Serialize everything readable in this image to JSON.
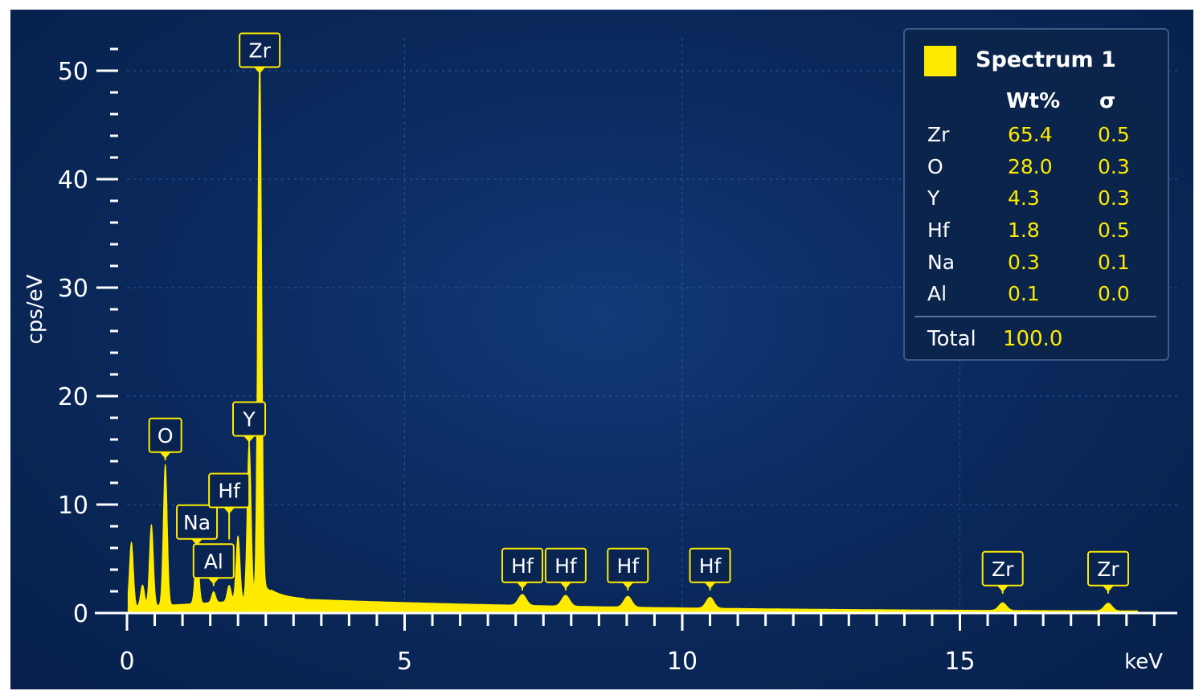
{
  "chart_data": {
    "type": "area",
    "xlabel": "keV",
    "ylabel": "cps/eV",
    "xlim": [
      0,
      18.5
    ],
    "ylim": [
      0,
      53
    ],
    "x_ticks": [
      0,
      5,
      10,
      15
    ],
    "y_ticks": [
      0,
      10,
      20,
      30,
      40,
      50
    ],
    "series_color": "#ffeb00",
    "background_color": "#0b2a5e",
    "background_level": 0.5,
    "peaks": [
      {
        "keV": 0.08,
        "height": 6.5,
        "label": ""
      },
      {
        "keV": 0.28,
        "height": 2.5,
        "label": ""
      },
      {
        "keV": 0.44,
        "height": 8.0,
        "label": ""
      },
      {
        "keV": 0.69,
        "height": 13.5,
        "label": "O"
      },
      {
        "keV": 1.26,
        "height": 5.5,
        "label": "Na"
      },
      {
        "keV": 1.56,
        "height": 1.5,
        "label": "Al"
      },
      {
        "keV": 1.84,
        "height": 2.0,
        "label": "Hf"
      },
      {
        "keV": 2.0,
        "height": 6.5,
        "label": ""
      },
      {
        "keV": 2.2,
        "height": 15.0,
        "label": "Y"
      },
      {
        "keV": 2.39,
        "height": 49.0,
        "label": "Zr"
      },
      {
        "keV": 7.12,
        "height": 1.5,
        "label": "Hf"
      },
      {
        "keV": 7.9,
        "height": 1.5,
        "label": "Hf"
      },
      {
        "keV": 9.02,
        "height": 1.5,
        "label": "Hf"
      },
      {
        "keV": 10.5,
        "height": 1.5,
        "label": "Hf"
      },
      {
        "keV": 15.77,
        "height": 1.2,
        "label": "Zr"
      },
      {
        "keV": 17.67,
        "height": 1.2,
        "label": "Zr"
      }
    ]
  },
  "legend": {
    "series_name": "Spectrum 1",
    "col_element": "",
    "col_wt": "Wt%",
    "col_sigma": "σ",
    "rows": [
      {
        "element": "Zr",
        "wt": "65.4",
        "sigma": "0.5"
      },
      {
        "element": "O",
        "wt": "28.0",
        "sigma": "0.3"
      },
      {
        "element": "Y",
        "wt": "4.3",
        "sigma": "0.3"
      },
      {
        "element": "Hf",
        "wt": "1.8",
        "sigma": "0.5"
      },
      {
        "element": "Na",
        "wt": "0.3",
        "sigma": "0.1"
      },
      {
        "element": "Al",
        "wt": "0.1",
        "sigma": "0.0"
      }
    ],
    "total_label": "Total",
    "total_value": "100.0"
  }
}
